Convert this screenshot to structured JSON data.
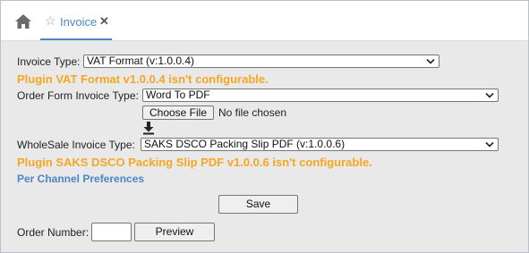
{
  "tabs": [
    {
      "label": "Invoice",
      "icon": "star-icon",
      "close": "✕"
    }
  ],
  "colors": {
    "accent": "#4a86c8",
    "warning": "#f5a623",
    "panel_bg": "#e9e9e9"
  },
  "form": {
    "invoice_type": {
      "label": "Invoice Type:",
      "value": "VAT Format (v:1.0.0.4)",
      "warning": "Plugin VAT Format v1.0.0.4 isn't configurable."
    },
    "order_form_invoice_type": {
      "label": "Order Form Invoice Type:",
      "value": "Word To PDF",
      "file_button": "Choose File",
      "file_status": "No file chosen",
      "download_icon": "download-icon"
    },
    "wholesale_invoice_type": {
      "label": "WholeSale Invoice Type:",
      "value": "SAKS DSCO Packing Slip PDF (v:1.0.0.6)",
      "warning": "Plugin SAKS DSCO Packing Slip PDF v1.0.0.6 isn't configurable."
    },
    "per_channel_link": "Per Channel Preferences",
    "save_button": "Save",
    "order_number": {
      "label": "Order Number:",
      "value": "",
      "preview_button": "Preview"
    }
  }
}
